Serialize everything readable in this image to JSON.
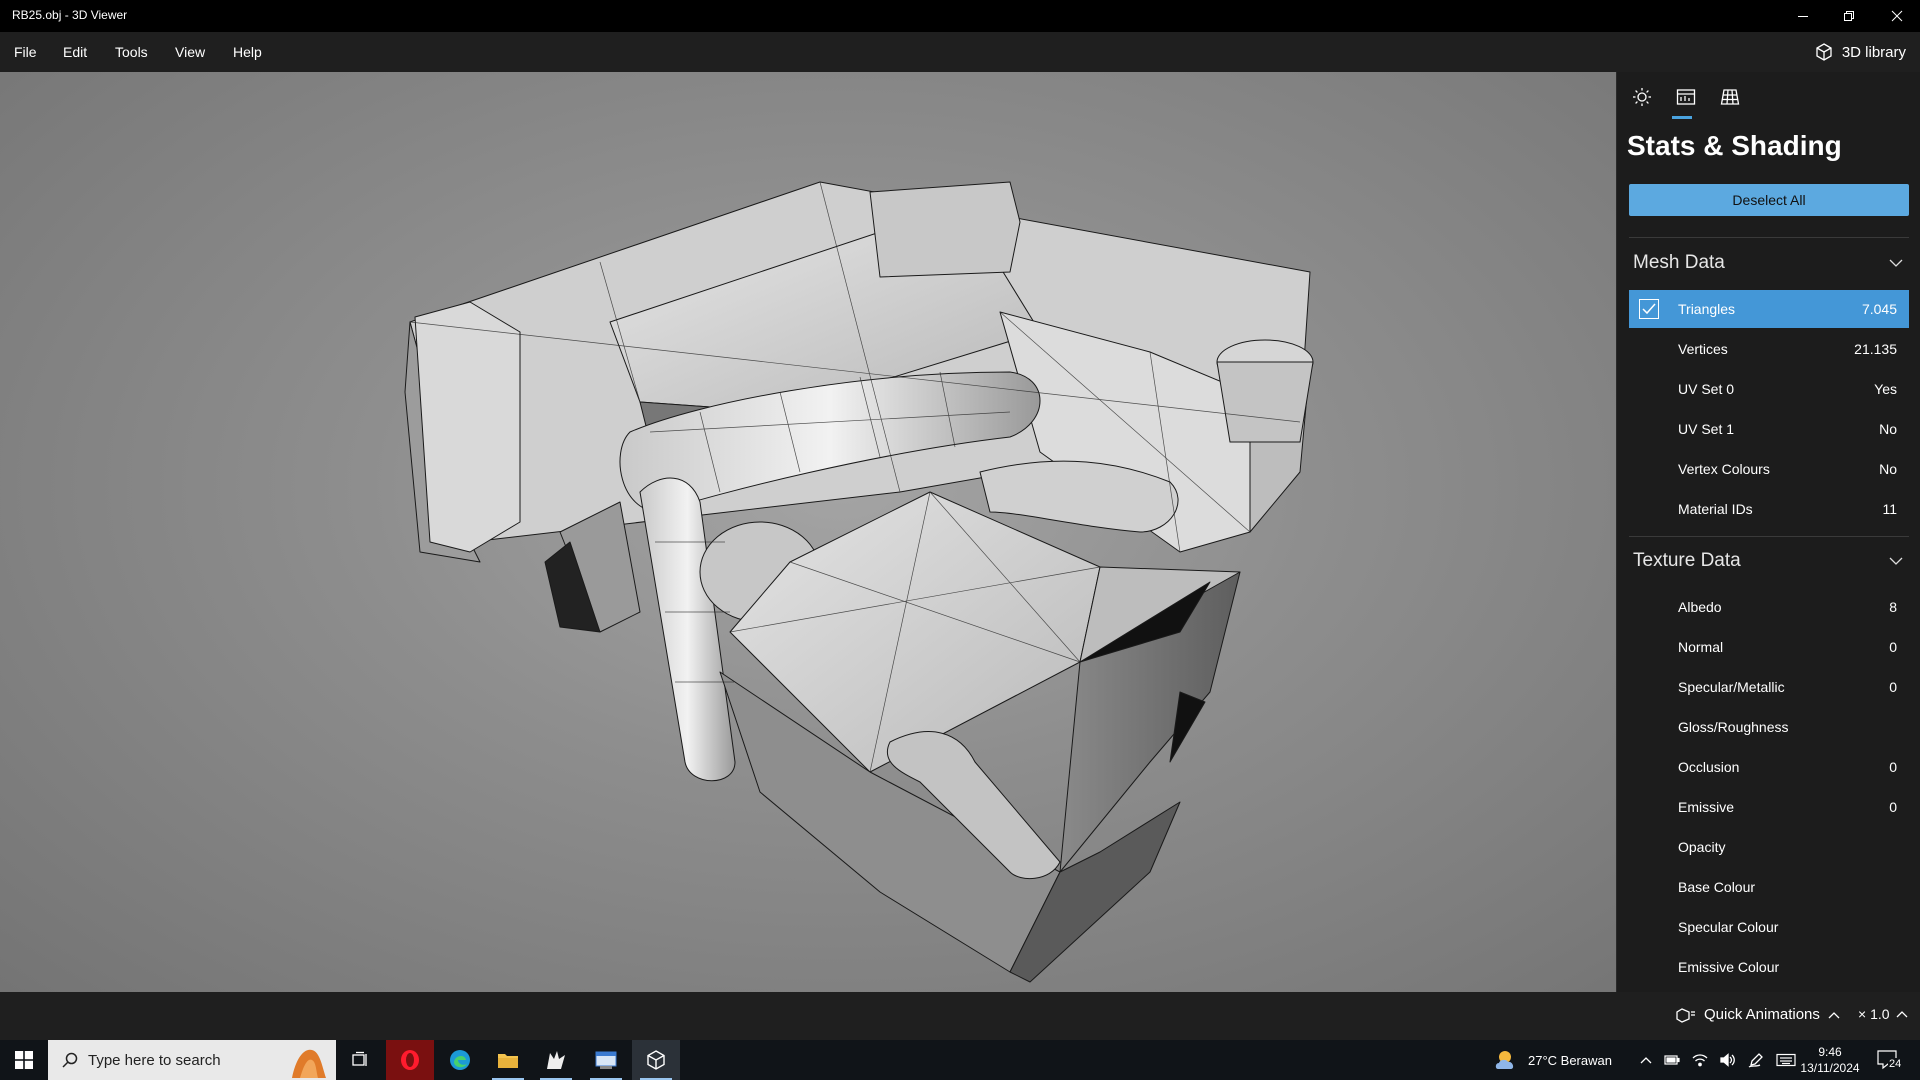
{
  "window": {
    "title": "RB25.obj - 3D Viewer"
  },
  "menu": {
    "items": [
      "File",
      "Edit",
      "Tools",
      "View",
      "Help"
    ],
    "library_label": "3D library"
  },
  "panel": {
    "tabs": [
      "lighting-icon",
      "stats-icon",
      "grid-icon"
    ],
    "active_tab": 1,
    "title": "Stats & Shading",
    "deselect_label": "Deselect All",
    "mesh_section": "Mesh Data",
    "mesh_rows": [
      {
        "name": "Triangles",
        "value": "7.045",
        "selected": true
      },
      {
        "name": "Vertices",
        "value": "21.135"
      },
      {
        "name": "UV Set 0",
        "value": "Yes"
      },
      {
        "name": "UV Set 1",
        "value": "No"
      },
      {
        "name": "Vertex Colours",
        "value": "No"
      },
      {
        "name": "Material IDs",
        "value": "11"
      }
    ],
    "texture_section": "Texture Data",
    "texture_rows": [
      {
        "name": "Albedo",
        "value": "8"
      },
      {
        "name": "Normal",
        "value": "0"
      },
      {
        "name": "Specular/Metallic",
        "value": "0"
      },
      {
        "name": "Gloss/Roughness",
        "value": ""
      },
      {
        "name": "Occlusion",
        "value": "0"
      },
      {
        "name": "Emissive",
        "value": "0"
      },
      {
        "name": "Opacity",
        "value": ""
      },
      {
        "name": "Base Colour",
        "value": ""
      },
      {
        "name": "Specular Colour",
        "value": ""
      },
      {
        "name": "Emissive Colour",
        "value": ""
      }
    ]
  },
  "status": {
    "quick_animations": "Quick Animations",
    "speed": "× 1.0"
  },
  "taskbar": {
    "search_placeholder": "Type here to search",
    "weather": "27°C  Berawan",
    "time": "9:46",
    "date": "13/11/2024",
    "notifications": "24"
  },
  "colors": {
    "accent": "#4497d7",
    "button": "#5ca9e0",
    "panel_bg": "#1c1c1c"
  }
}
